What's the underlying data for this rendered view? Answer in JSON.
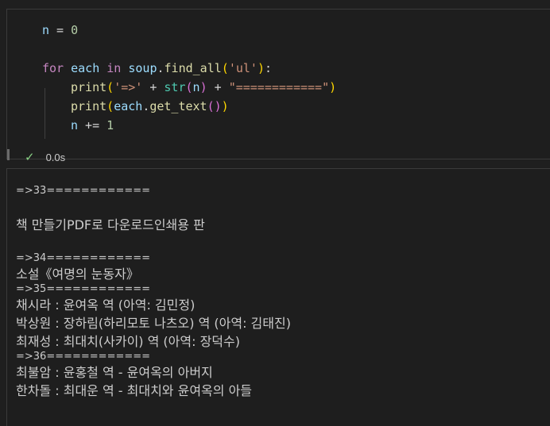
{
  "code_cell": {
    "lines": [
      [
        {
          "t": "n",
          "c": "var"
        },
        {
          "t": " = ",
          "c": "op"
        },
        {
          "t": "0",
          "c": "num"
        }
      ],
      [],
      [
        {
          "t": "for",
          "c": "kw"
        },
        {
          "t": " ",
          "c": "op"
        },
        {
          "t": "each",
          "c": "var"
        },
        {
          "t": " ",
          "c": "op"
        },
        {
          "t": "in",
          "c": "kw"
        },
        {
          "t": " ",
          "c": "op"
        },
        {
          "t": "soup",
          "c": "var"
        },
        {
          "t": ".",
          "c": "op"
        },
        {
          "t": "find_all",
          "c": "fn"
        },
        {
          "t": "(",
          "c": "p1"
        },
        {
          "t": "'ul'",
          "c": "str"
        },
        {
          "t": ")",
          "c": "p1"
        },
        {
          "t": ":",
          "c": "op"
        }
      ],
      [
        {
          "indent": 1
        },
        {
          "t": "print",
          "c": "fn"
        },
        {
          "t": "(",
          "c": "p1"
        },
        {
          "t": "'=>'",
          "c": "str"
        },
        {
          "t": " + ",
          "c": "op"
        },
        {
          "t": "str",
          "c": "bi"
        },
        {
          "t": "(",
          "c": "p2"
        },
        {
          "t": "n",
          "c": "var"
        },
        {
          "t": ")",
          "c": "p2"
        },
        {
          "t": " + ",
          "c": "op"
        },
        {
          "t": "\"============\"",
          "c": "str"
        },
        {
          "t": ")",
          "c": "p1"
        }
      ],
      [
        {
          "indent": 1
        },
        {
          "t": "print",
          "c": "fn"
        },
        {
          "t": "(",
          "c": "p1"
        },
        {
          "t": "each",
          "c": "var"
        },
        {
          "t": ".",
          "c": "op"
        },
        {
          "t": "get_text",
          "c": "fn"
        },
        {
          "t": "(",
          "c": "p2"
        },
        {
          "t": ")",
          "c": "p2"
        },
        {
          "t": ")",
          "c": "p1"
        }
      ],
      [
        {
          "indent": 1
        },
        {
          "t": "n",
          "c": "var"
        },
        {
          "t": " += ",
          "c": "op"
        },
        {
          "t": "1",
          "c": "num"
        }
      ]
    ],
    "status": {
      "icon": "check-icon",
      "time": "0.0s",
      "color": "#89d185"
    }
  },
  "output": {
    "lines": [
      {
        "text": "=>33============",
        "kind": "sep"
      },
      {
        "text": "",
        "kind": "blank"
      },
      {
        "text": "책 만들기PDF로 다운로드인쇄용 판",
        "kind": "kor"
      },
      {
        "text": "",
        "kind": "blank"
      },
      {
        "text": "=>34============",
        "kind": "sep"
      },
      {
        "text": "소설《여명의 눈동자》",
        "kind": "kor"
      },
      {
        "text": "=>35============",
        "kind": "sep"
      },
      {
        "text": "채시라 : 윤여옥 역 (아역: 김민정)",
        "kind": "kor"
      },
      {
        "text": "박상원 : 장하림(하리모토 나츠오) 역 (아역: 김태진)",
        "kind": "kor"
      },
      {
        "text": "최재성 : 최대치(사카이) 역 (아역: 장덕수)",
        "kind": "kor"
      },
      {
        "text": "=>36============",
        "kind": "sep"
      },
      {
        "text": "최불암 : 윤홍철 역 - 윤여옥의 아버지",
        "kind": "kor"
      },
      {
        "text": "한차돌 : 최대운 역 - 최대치와 윤여옥의 아들",
        "kind": "kor"
      }
    ]
  }
}
